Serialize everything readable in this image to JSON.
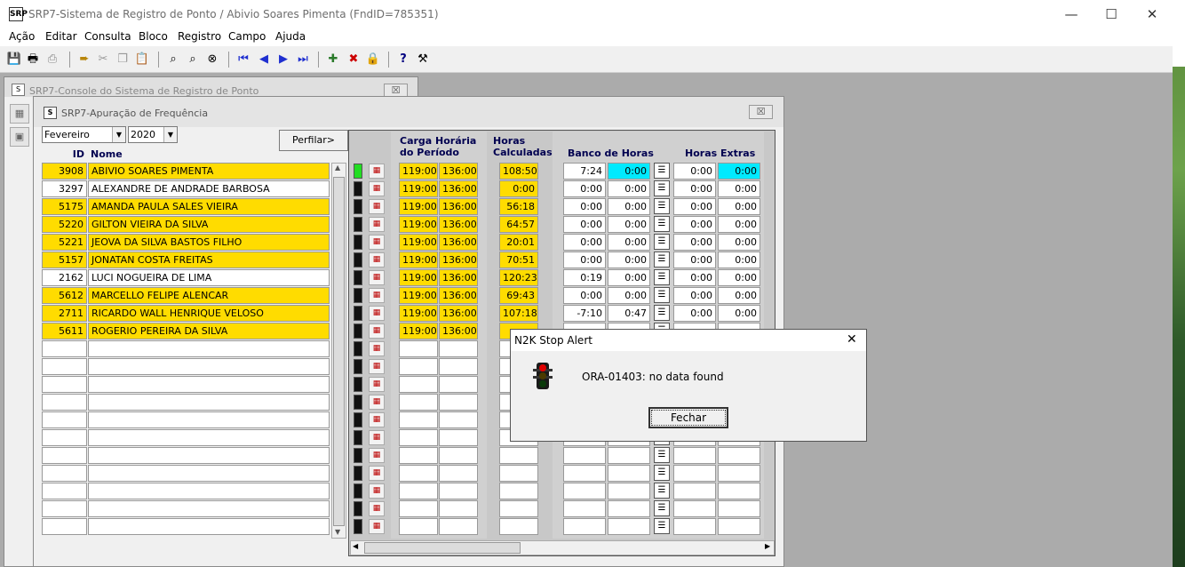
{
  "window": {
    "title": "SRP7-Sistema de Registro de Ponto / Abivio Soares Pimenta (FndID=785351)",
    "title_icon": "SRP",
    "minimize": "—",
    "maximize": "☐",
    "close": "✕"
  },
  "menu": [
    "Ação",
    "Editar",
    "Consulta",
    "Bloco",
    "Registro",
    "Campo",
    "Ajuda"
  ],
  "toolbar_icons": [
    "save-icon",
    "print-icon",
    "print-setup-icon",
    "exit-icon",
    "cut-icon",
    "copy-icon",
    "paste-icon",
    "query-icon",
    "execute-query-icon",
    "cancel-query-icon",
    "first-record-icon",
    "previous-record-icon",
    "next-record-icon",
    "last-record-icon",
    "insert-record-icon",
    "delete-record-icon",
    "lock-record-icon",
    "help-icon",
    "tools-icon"
  ],
  "console": {
    "title": "SRP7-Console do Sistema de Registro de Ponto",
    "close": "☒"
  },
  "form": {
    "title": "SRP7-Apuração de Frequência",
    "close": "☒",
    "month": "Fevereiro",
    "year": "2020",
    "profile_button": "Perfilar>",
    "col_id": "ID",
    "col_nome": "Nome",
    "hdr_carga_1": "Carga Horária",
    "hdr_carga_2": "do Período",
    "hdr_horas_1": "Horas",
    "hdr_horas_2": "Calculadas",
    "hdr_banco": "Banco de Horas",
    "hdr_extras": "Horas Extras"
  },
  "rows": [
    {
      "id": "3908",
      "nome": "ABIVIO SOARES PIMENTA",
      "carga": "119:00",
      "periodo": "136:00",
      "calc": "108:50",
      "banco1": "7:24",
      "banco2": "0:00",
      "extra1": "0:00",
      "extra2": "0:00",
      "hl": true,
      "status": "green",
      "cyan": true
    },
    {
      "id": "3297",
      "nome": "ALEXANDRE DE ANDRADE BARBOSA",
      "carga": "119:00",
      "periodo": "136:00",
      "calc": "0:00",
      "banco1": "0:00",
      "banco2": "0:00",
      "extra1": "0:00",
      "extra2": "0:00",
      "hl": false,
      "status": "black",
      "cyan": false
    },
    {
      "id": "5175",
      "nome": "AMANDA PAULA SALES VIEIRA",
      "carga": "119:00",
      "periodo": "136:00",
      "calc": "56:18",
      "banco1": "0:00",
      "banco2": "0:00",
      "extra1": "0:00",
      "extra2": "0:00",
      "hl": true,
      "status": "black",
      "cyan": false
    },
    {
      "id": "5220",
      "nome": "GILTON VIEIRA DA SILVA",
      "carga": "119:00",
      "periodo": "136:00",
      "calc": "64:57",
      "banco1": "0:00",
      "banco2": "0:00",
      "extra1": "0:00",
      "extra2": "0:00",
      "hl": true,
      "status": "black",
      "cyan": false
    },
    {
      "id": "5221",
      "nome": "JEOVA DA SILVA BASTOS FILHO",
      "carga": "119:00",
      "periodo": "136:00",
      "calc": "20:01",
      "banco1": "0:00",
      "banco2": "0:00",
      "extra1": "0:00",
      "extra2": "0:00",
      "hl": true,
      "status": "black",
      "cyan": false
    },
    {
      "id": "5157",
      "nome": "JONATAN COSTA FREITAS",
      "carga": "119:00",
      "periodo": "136:00",
      "calc": "70:51",
      "banco1": "0:00",
      "banco2": "0:00",
      "extra1": "0:00",
      "extra2": "0:00",
      "hl": true,
      "status": "black",
      "cyan": false
    },
    {
      "id": "2162",
      "nome": "LUCI NOGUEIRA DE LIMA",
      "carga": "119:00",
      "periodo": "136:00",
      "calc": "120:23",
      "banco1": "0:19",
      "banco2": "0:00",
      "extra1": "0:00",
      "extra2": "0:00",
      "hl": false,
      "status": "black",
      "cyan": false
    },
    {
      "id": "5612",
      "nome": "MARCELLO FELIPE ALENCAR",
      "carga": "119:00",
      "periodo": "136:00",
      "calc": "69:43",
      "banco1": "0:00",
      "banco2": "0:00",
      "extra1": "0:00",
      "extra2": "0:00",
      "hl": true,
      "status": "black",
      "cyan": false
    },
    {
      "id": "2711",
      "nome": "RICARDO WALL HENRIQUE VELOSO",
      "carga": "119:00",
      "periodo": "136:00",
      "calc": "107:18",
      "banco1": "-7:10",
      "banco2": "0:47",
      "extra1": "0:00",
      "extra2": "0:00",
      "hl": true,
      "status": "black",
      "cyan": false
    },
    {
      "id": "5611",
      "nome": "ROGERIO PEREIRA DA SILVA",
      "carga": "119:00",
      "periodo": "136:00",
      "calc": "",
      "banco1": "",
      "banco2": "",
      "extra1": "",
      "extra2": "",
      "hl": true,
      "status": "black",
      "cyan": false
    }
  ],
  "empty_rows": 11,
  "dialog": {
    "title": "N2K Stop Alert",
    "message": "ORA-01403: no data found",
    "button": "Fechar",
    "close": "✕"
  }
}
